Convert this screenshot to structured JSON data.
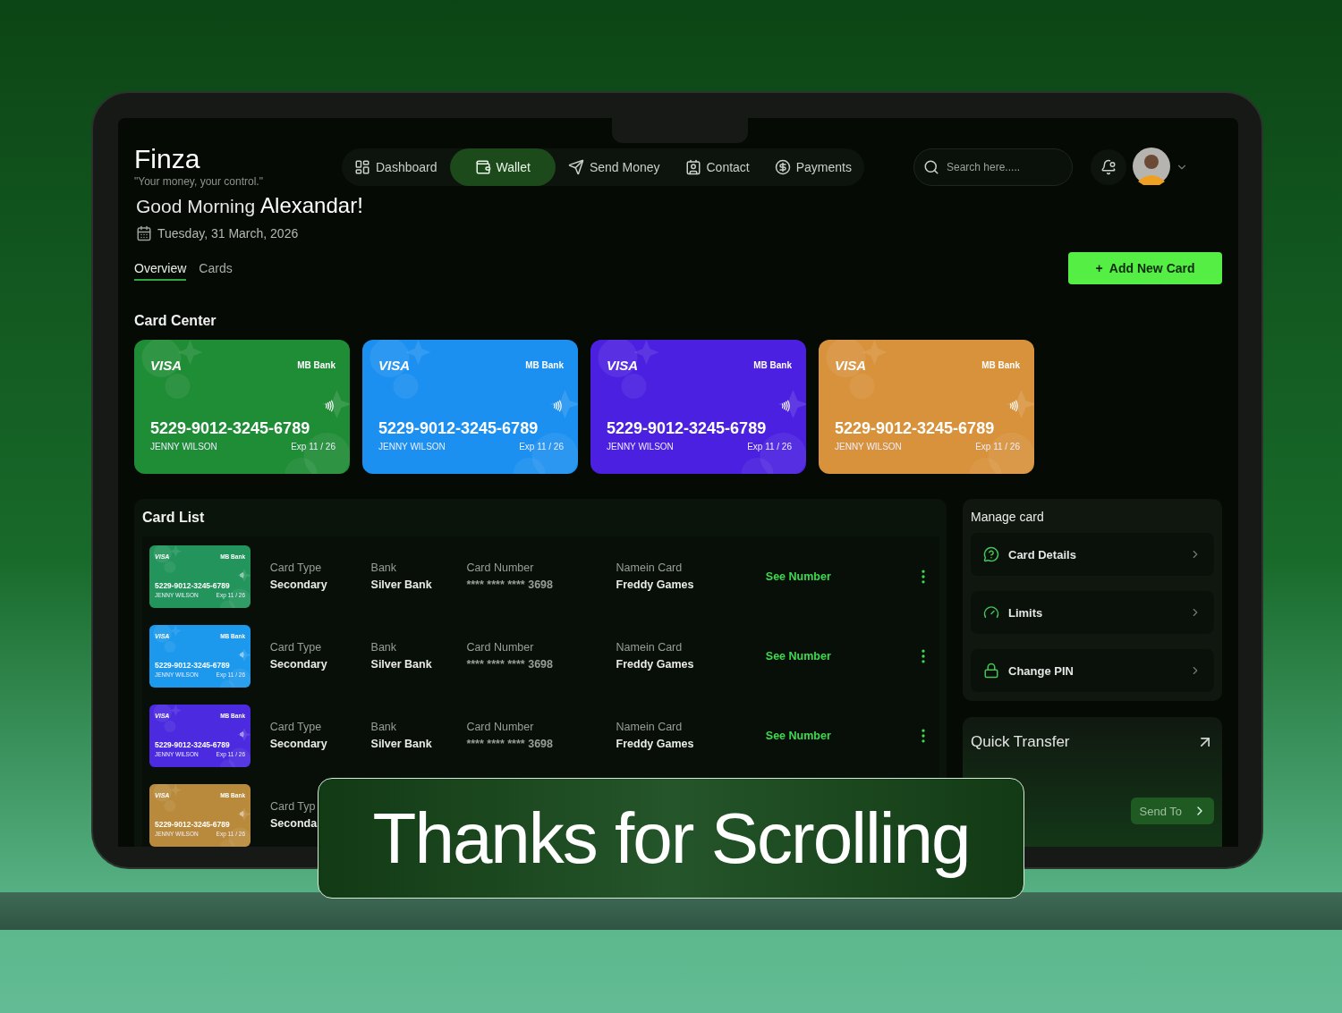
{
  "brand": {
    "name": "Finza",
    "tagline": "\"Your money, your control.\""
  },
  "nav": [
    {
      "label": "Dashboard",
      "selected": false
    },
    {
      "label": "Wallet",
      "selected": true
    },
    {
      "label": "Send Money",
      "selected": false
    },
    {
      "label": "Contact",
      "selected": false
    },
    {
      "label": "Payments",
      "selected": false
    }
  ],
  "search": {
    "placeholder": "Search here....."
  },
  "greeting": {
    "salutation": "Good Morning",
    "name": "Alexandar!",
    "date": "Tuesday, 31 March, 2026"
  },
  "tabs": [
    {
      "label": "Overview",
      "selected": true
    },
    {
      "label": "Cards",
      "selected": false
    }
  ],
  "add_button": "+  Add New Card",
  "card_center": {
    "title": "Card Center",
    "cards": [
      {
        "network": "VISA",
        "bank": "MB Bank",
        "number": "5229-9012-3245-6789",
        "holder": "JENNY WILSON",
        "expiry": "Exp 11 / 26",
        "color": "#1f8c36"
      },
      {
        "network": "VISA",
        "bank": "MB Bank",
        "number": "5229-9012-3245-6789",
        "holder": "JENNY WILSON",
        "expiry": "Exp 11 / 26",
        "color": "#1c90f0"
      },
      {
        "network": "VISA",
        "bank": "MB Bank",
        "number": "5229-9012-3245-6789",
        "holder": "JENNY WILSON",
        "expiry": "Exp 11 / 26",
        "color": "#4b20e0"
      },
      {
        "network": "VISA",
        "bank": "MB Bank",
        "number": "5229-9012-3245-6789",
        "holder": "JENNY WILSON",
        "expiry": "Exp 11 / 26",
        "color": "#d8923c"
      }
    ]
  },
  "card_list": {
    "title": "Card List",
    "rows": [
      {
        "card": {
          "network": "VISA",
          "bank": "MB Bank",
          "number": "5229-9012-3245-6789",
          "holder": "JENNY WILSON",
          "expiry": "Exp 11 / 26",
          "color": "#23955c"
        },
        "fields": [
          {
            "label": "Card Type",
            "value": "Secondary"
          },
          {
            "label": "Bank",
            "value": "Silver Bank"
          },
          {
            "label": "Card Number",
            "value": "**** **** **** 3698"
          },
          {
            "label": "Namein Card",
            "value": "Freddy Games"
          }
        ],
        "action": "See Number"
      },
      {
        "card": {
          "network": "VISA",
          "bank": "MB Bank",
          "number": "5229-9012-3245-6789",
          "holder": "JENNY WILSON",
          "expiry": "Exp 11 / 26",
          "color": "#1c98ec"
        },
        "fields": [
          {
            "label": "Card Type",
            "value": "Secondary"
          },
          {
            "label": "Bank",
            "value": "Silver Bank"
          },
          {
            "label": "Card Number",
            "value": "**** **** **** 3698"
          },
          {
            "label": "Namein Card",
            "value": "Freddy Games"
          }
        ],
        "action": "See Number"
      },
      {
        "card": {
          "network": "VISA",
          "bank": "MB Bank",
          "number": "5229-9012-3245-6789",
          "holder": "JENNY WILSON",
          "expiry": "Exp 11 / 26",
          "color": "#4b2ae0"
        },
        "fields": [
          {
            "label": "Card Type",
            "value": "Secondary"
          },
          {
            "label": "Bank",
            "value": "Silver Bank"
          },
          {
            "label": "Card Number",
            "value": "**** **** **** 3698"
          },
          {
            "label": "Namein Card",
            "value": "Freddy Games"
          }
        ],
        "action": "See Number"
      },
      {
        "card": {
          "network": "VISA",
          "bank": "MB Bank",
          "number": "5229-9012-3245-6789",
          "holder": "JENNY WILSON",
          "expiry": "Exp 11 / 26",
          "color": "#b98a3c"
        },
        "fields": [
          {
            "label": "Card Typ",
            "value": "Seconda"
          }
        ]
      }
    ]
  },
  "manage_card": {
    "title": "Manage card",
    "items": [
      "Card Details",
      "Limits",
      "Change PIN"
    ]
  },
  "quick_transfer": {
    "title": "Quick Transfer",
    "button": "Send To"
  },
  "overlay": {
    "text": "Thanks for Scrolling"
  }
}
